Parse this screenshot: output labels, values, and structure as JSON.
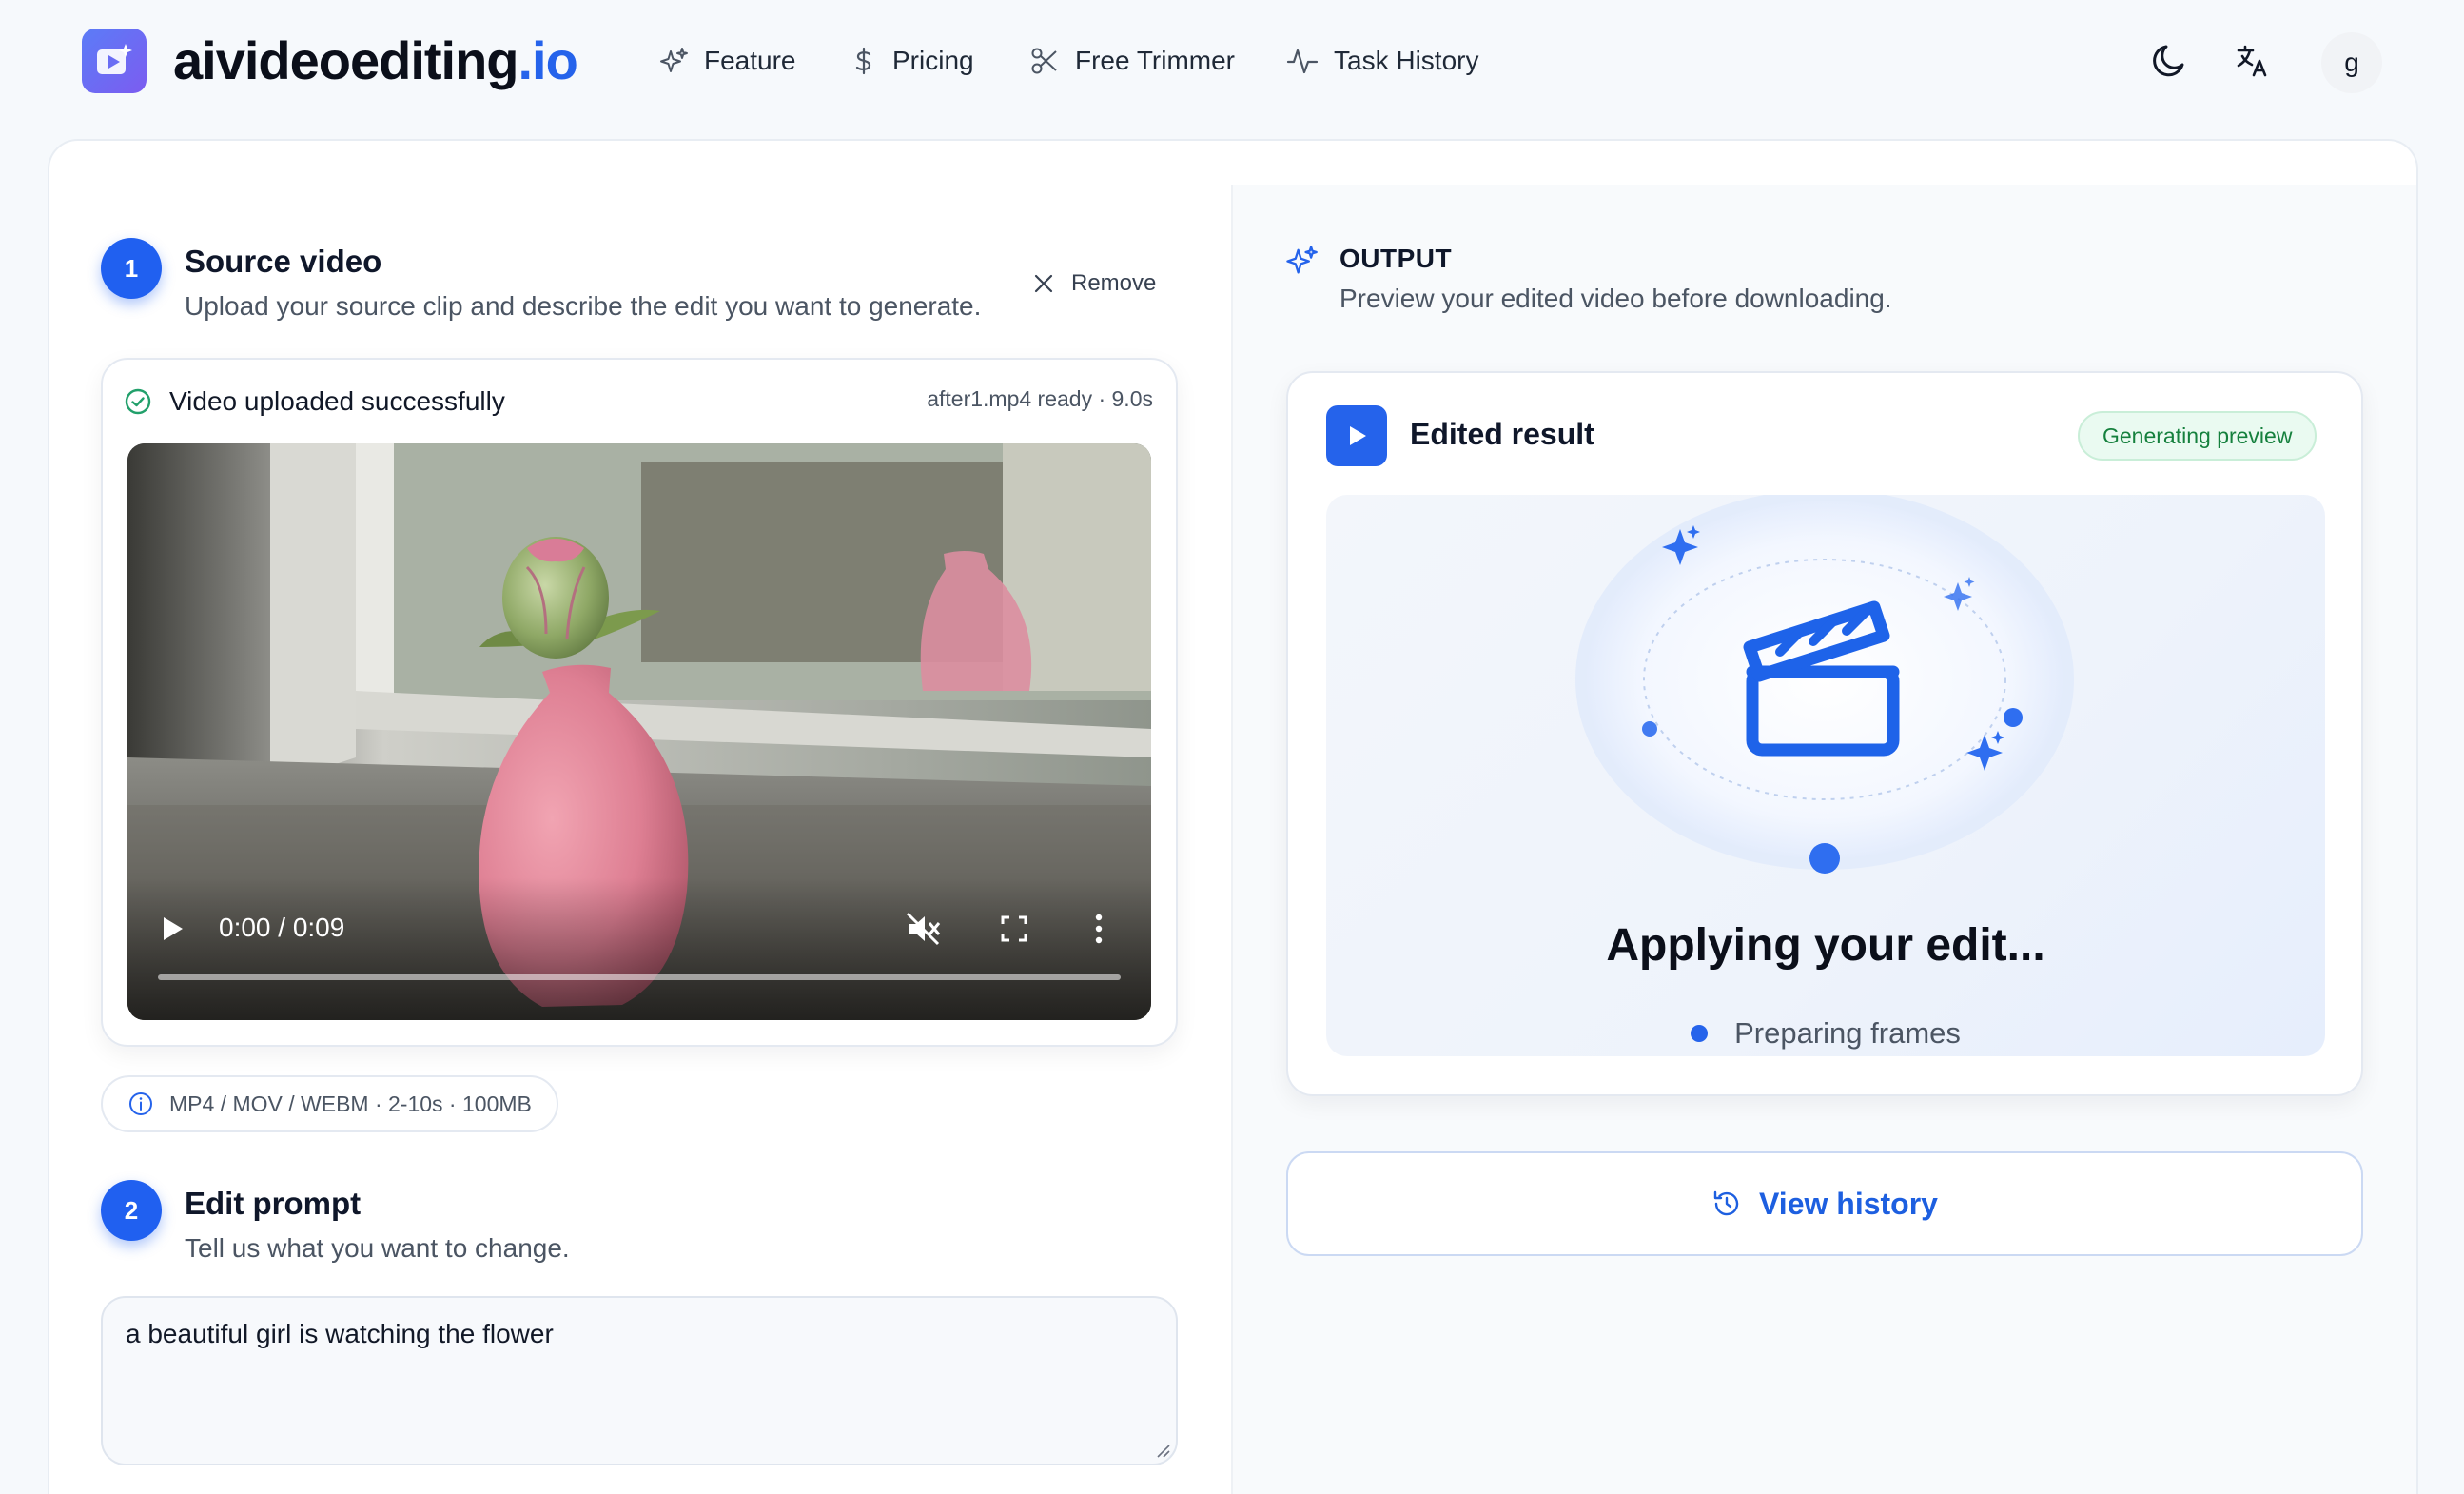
{
  "brand": {
    "name": "aivideoediting",
    "tld": ".io"
  },
  "nav": [
    {
      "label": "Feature",
      "icon": "sparkles-icon"
    },
    {
      "label": "Pricing",
      "icon": "dollar-icon"
    },
    {
      "label": "Free Trimmer",
      "icon": "scissors-icon"
    },
    {
      "label": "Task History",
      "icon": "activity-icon"
    }
  ],
  "header": {
    "avatar_letter": "g"
  },
  "source": {
    "step": "1",
    "title": "Source video",
    "subtitle": "Upload your source clip and describe the edit you want to generate.",
    "remove_label": "Remove",
    "upload_status": "Video uploaded successfully",
    "file_meta": "after1.mp4 ready · 9.0s",
    "player": {
      "time": "0:00 / 0:09",
      "progress": 0
    },
    "formats": "MP4 / MOV / WEBM · 2-10s · 100MB"
  },
  "prompt": {
    "step": "2",
    "title": "Edit prompt",
    "subtitle": "Tell us what you want to change.",
    "value": "a beautiful girl is watching the flower"
  },
  "output": {
    "title": "OUTPUT",
    "subtitle": "Preview your edited video before downloading.",
    "card_title": "Edited result",
    "badge": "Generating preview",
    "status_title": "Applying your edit...",
    "status_step": "Preparing frames",
    "history_label": "View history"
  },
  "colors": {
    "accent": "#2563eb",
    "success": "#15803d",
    "badge_bg": "#eafaf1"
  }
}
